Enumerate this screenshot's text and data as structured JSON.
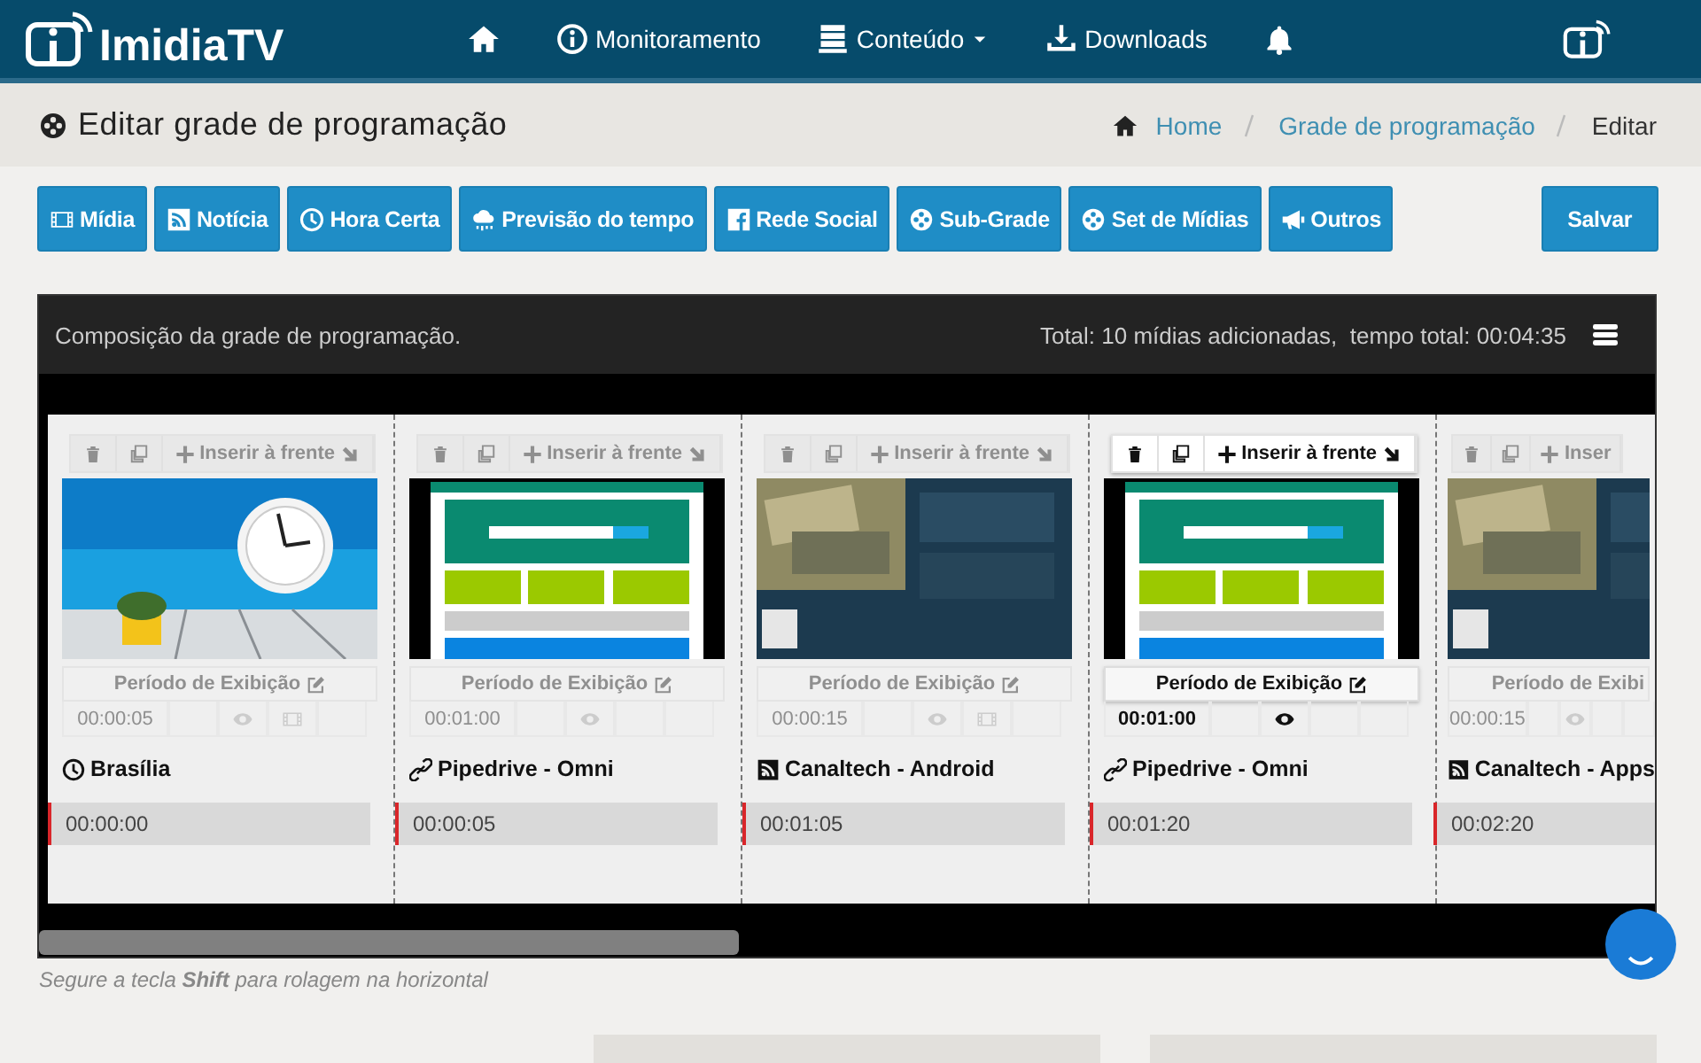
{
  "app": {
    "logo": "ImidiaTV"
  },
  "nav": [
    {
      "kind": "home"
    },
    {
      "kind": "monitor",
      "label": "Monitoramento"
    },
    {
      "kind": "content",
      "label": "Conteúdo",
      "dropdown": true
    },
    {
      "kind": "download",
      "label": "Downloads"
    },
    {
      "kind": "alerts"
    }
  ],
  "page": {
    "title": "Editar grade de programação"
  },
  "breadcrumb": [
    {
      "label": "Home",
      "current": false
    },
    {
      "label": "Grade de programação",
      "current": false
    },
    {
      "label": "Editar",
      "current": true
    }
  ],
  "toolbar": [
    {
      "kind": "media",
      "label": "Mídia"
    },
    {
      "kind": "news",
      "label": "Notícia"
    },
    {
      "kind": "time",
      "label": "Hora Certa"
    },
    {
      "kind": "weather",
      "label": "Previsão do tempo"
    },
    {
      "kind": "social",
      "label": "Rede Social"
    },
    {
      "kind": "grid",
      "label": "Sub-Grade"
    },
    {
      "kind": "grid",
      "label": "Set de Mídias"
    },
    {
      "kind": "other",
      "label": "Outros"
    }
  ],
  "save_button": "Salvar",
  "panel": {
    "title": "Composição da grade de programação.",
    "summary": "Total: 10 mídias adicionadas,  tempo total: 00:04:35"
  },
  "cards": [
    {
      "kind": "time",
      "title": "Brasília",
      "insert_label": "Inserir à frente",
      "period_label": "Período de Exibição",
      "duration": "00:00:05",
      "video_icon": true,
      "start": "00:00:00",
      "active": false
    },
    {
      "kind": "site",
      "title": "Pipedrive - Omni",
      "insert_label": "Inserir à frente",
      "period_label": "Período de Exibição",
      "duration": "00:01:00",
      "video_icon": false,
      "start": "00:00:05",
      "active": false
    },
    {
      "kind": "news",
      "title": "Canaltech - Android",
      "insert_label": "Inserir à frente",
      "period_label": "Período de Exibição",
      "duration": "00:00:15",
      "video_icon": true,
      "start": "00:01:05",
      "active": false
    },
    {
      "kind": "site",
      "title": "Pipedrive - Omni",
      "insert_label": "Inserir à frente",
      "period_label": "Período de Exibição",
      "duration": "00:01:00",
      "video_icon": false,
      "start": "00:01:20",
      "active": true
    },
    {
      "kind": "news",
      "title": "Canaltech - Apps",
      "insert_label": "Inser",
      "period_label": "Período de Exibi",
      "duration": "00:00:15",
      "video_icon": false,
      "start": "00:02:20",
      "active": false
    }
  ],
  "hint": "Segure a tecla **Shift** para rolagem na horizontal"
}
